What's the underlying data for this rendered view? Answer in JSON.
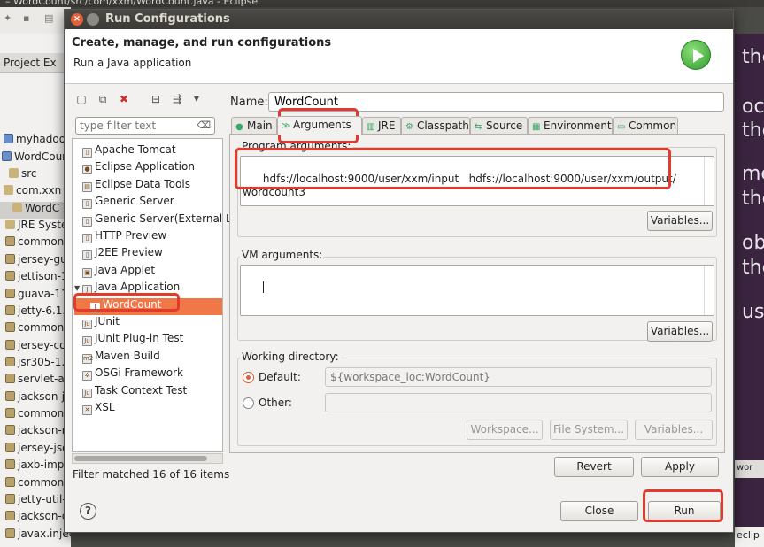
{
  "background": {
    "title": "– WordCount/src/com/xxm/WordCount.java - Eclipse",
    "project_explorer": "Project Ex",
    "rows": [
      "myhadoo",
      "WordCoun",
      "src",
      "com.xxn",
      "WordC",
      "JRE Syste",
      "commons",
      "jersey-gui",
      "jettison-1",
      "guava-11.",
      "jetty-6.1.",
      "commons",
      "jersey-cor",
      "jsr305-1.3",
      "servlet-ap",
      "jackson-ja",
      "commons",
      "jackson-m",
      "jersey-jso",
      "jaxb-impl",
      "commons",
      "jetty-util-",
      "jackson-c",
      "javax.inject-1.jar - /us"
    ],
    "right_words": [
      "the",
      "ock",
      "the",
      "me",
      "the",
      "obt",
      "the",
      "ust"
    ],
    "right_panel_text": "wor",
    "right_bottom_text": "eclip"
  },
  "dialog": {
    "title": "Run Configurations",
    "banner_heading": "Create, manage, and run configurations",
    "banner_sub": "Run a Java application",
    "filter_placeholder": "type filter text",
    "tree": [
      {
        "label": "Apache Tomcat",
        "icon": "tomcat-icon"
      },
      {
        "label": "Eclipse Application",
        "icon": "eclipse-icon"
      },
      {
        "label": "Eclipse Data Tools",
        "icon": "database-icon"
      },
      {
        "label": "Generic Server",
        "icon": "server-icon"
      },
      {
        "label": "Generic Server(External L",
        "icon": "server-icon"
      },
      {
        "label": "HTTP Preview",
        "icon": "server-icon"
      },
      {
        "label": "J2EE Preview",
        "icon": "server-icon"
      },
      {
        "label": "Java Applet",
        "icon": "applet-icon"
      },
      {
        "label": "Java Application",
        "icon": "java-app-icon"
      },
      {
        "label": "WordCount",
        "icon": "java-app-icon"
      },
      {
        "label": "JUnit",
        "icon": "junit-icon"
      },
      {
        "label": "JUnit Plug-in Test",
        "icon": "junit-icon"
      },
      {
        "label": "Maven Build",
        "icon": "maven-icon"
      },
      {
        "label": "OSGi Framework",
        "icon": "osgi-icon"
      },
      {
        "label": "Task Context Test",
        "icon": "junit-icon"
      },
      {
        "label": "XSL",
        "icon": "xsl-icon"
      }
    ],
    "filter_status": "Filter matched 16 of 16 items",
    "name_label": "Name:",
    "name_value": "WordCount",
    "tabs": [
      {
        "label": "Main",
        "icon": "main-icon"
      },
      {
        "label": "Arguments",
        "icon": "arguments-icon"
      },
      {
        "label": "JRE",
        "icon": "jre-icon"
      },
      {
        "label": "Classpath",
        "icon": "classpath-icon"
      },
      {
        "label": "Source",
        "icon": "source-icon"
      },
      {
        "label": "Environment",
        "icon": "environment-icon"
      },
      {
        "label": "Common",
        "icon": "common-icon"
      }
    ],
    "program_arguments_label": "Program arguments:",
    "program_arguments": "hdfs://localhost:9000/user/xxm/input   hdfs://localhost:9000/user/xxm/output/\nwordcount3",
    "variables_label": "Variables...",
    "vm_arguments_label": "VM arguments:",
    "vm_arguments": "",
    "working_directory_label": "Working directory:",
    "default_label": "Default:",
    "default_value": "${workspace_loc:WordCount}",
    "other_label": "Other:",
    "other_value": "",
    "workspace_button": "Workspace...",
    "filesystem_button": "File System...",
    "variables_button_wd": "Variables...",
    "revert_button": "Revert",
    "apply_button": "Apply",
    "close_button": "Close",
    "run_button": "Run"
  }
}
